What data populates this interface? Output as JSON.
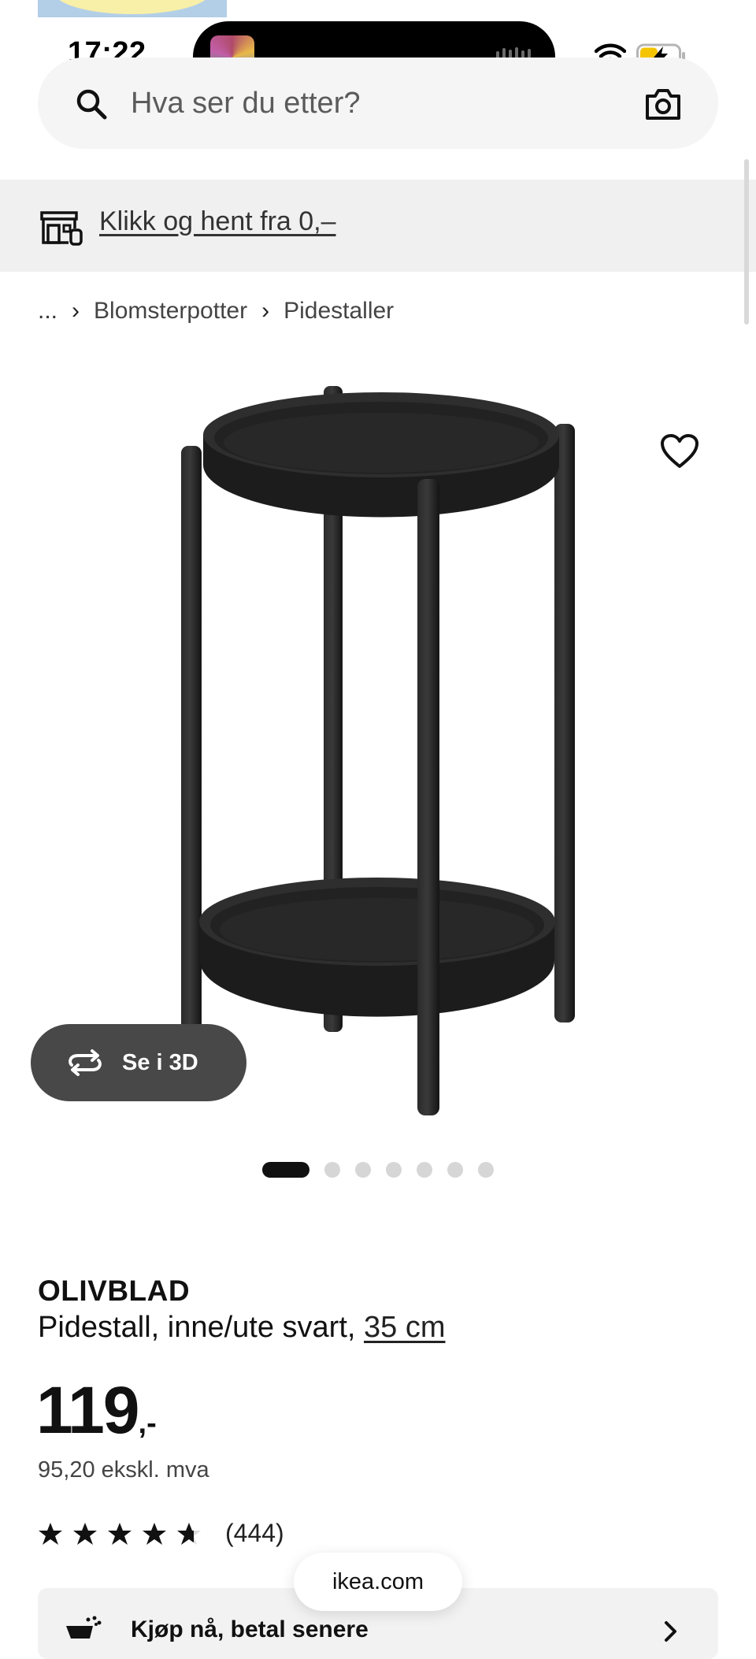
{
  "status_bar": {
    "time": "17:22"
  },
  "search": {
    "placeholder": "Hva ser du etter?"
  },
  "promo": {
    "link_text": "Klikk og hent fra 0,–"
  },
  "breadcrumb": {
    "ellipsis": "...",
    "items": [
      "Blomsterpotter",
      "Pidestaller"
    ]
  },
  "media": {
    "view_3d_label": "Se i 3D",
    "dots_total": 7,
    "active_dot": 1
  },
  "product": {
    "name": "OLIVBLAD",
    "description": "Pidestall, inne/ute svart, ",
    "size_link": "35 cm",
    "price": "119",
    "price_suffix": ",-",
    "price_ex_vat": "95,20 ekskl. mva",
    "rating": 4.7,
    "review_count": "(444)"
  },
  "klarna": {
    "label": "Kjøp nå, betal senere"
  },
  "browser": {
    "url": "ikea.com"
  },
  "colors": {
    "accent": "#111111",
    "button_bg": "#484848",
    "banner_bg": "#f0f0f0"
  }
}
